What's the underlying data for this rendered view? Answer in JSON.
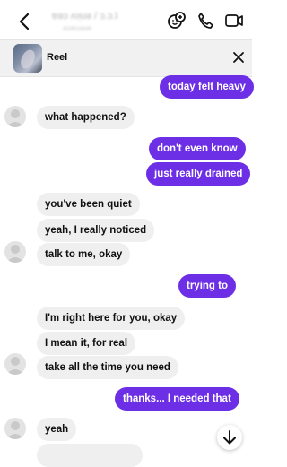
{
  "header": {
    "contact_name": "ɐǝɔ ʌıᴉuǝ / ɔ.ɔ.ʇ",
    "contact_sub": "ǝɔıɐɹɹǝɹɐ"
  },
  "reel": {
    "label": "Reel"
  },
  "messages": [
    {
      "side": "out",
      "text": "today felt heavy"
    },
    {
      "side": "in",
      "text": "what happened?"
    },
    {
      "side": "out",
      "text": "don't even know"
    },
    {
      "side": "out",
      "text": "just really drained"
    },
    {
      "side": "in",
      "text": "you've been quiet"
    },
    {
      "side": "in",
      "text": "yeah, I really noticed"
    },
    {
      "side": "in",
      "text": "talk to me, okay"
    },
    {
      "side": "out",
      "text": "trying to"
    },
    {
      "side": "in",
      "text": "I'm right here for you, okay"
    },
    {
      "side": "in",
      "text": "I mean it, for real"
    },
    {
      "side": "in",
      "text": "take all the time you need"
    },
    {
      "side": "out",
      "text": "thanks... I needed that"
    },
    {
      "side": "in",
      "text": "yeah"
    }
  ],
  "colors": {
    "outgoing_bubble": "#6d2fe6",
    "incoming_bubble": "#efefef",
    "accent_icons": "#111111"
  },
  "icons": [
    "back-icon",
    "effects-icon",
    "phone-icon",
    "video-icon",
    "close-icon",
    "avatar-icon",
    "arrow-down-icon"
  ]
}
